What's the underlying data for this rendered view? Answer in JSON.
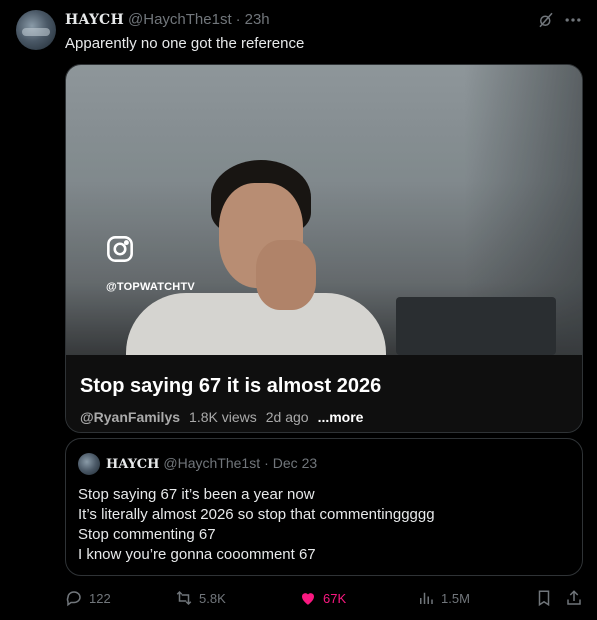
{
  "tweet": {
    "display_name": "HAYCH",
    "handle": "@HaychThe1st",
    "separator": "·",
    "time": "23h",
    "text": "Apparently no one got the reference"
  },
  "media": {
    "overlay_handle": "@TOPWATCHTV",
    "title": "Stop saying 67 it is almost 2026",
    "channel": "@RyanFamilys",
    "views": "1.8K views",
    "age": "2d ago",
    "more_label": "...more"
  },
  "quote": {
    "display_name": "HAYCH",
    "handle": "@HaychThe1st",
    "separator": "·",
    "date": "Dec 23",
    "lines": [
      "Stop saying 67 it’s been a year now",
      "It’s literally almost 2026 so stop that commentinggggg",
      "Stop commenting 67",
      "I know you’re gonna cooomment 67"
    ]
  },
  "actions": {
    "replies": "122",
    "reposts": "5.8K",
    "likes": "67K",
    "views": "1.5M"
  },
  "icons": {
    "grok": "grok-icon",
    "more": "more-icon",
    "instagram": "instagram-icon",
    "reply": "reply-icon",
    "retweet": "retweet-icon",
    "like": "heart-icon",
    "views": "views-icon",
    "bookmark": "bookmark-icon",
    "share": "share-icon"
  },
  "colors": {
    "background": "#000000",
    "text": "#e7e9ea",
    "muted": "#71767b",
    "like_active": "#f91880",
    "border": "#2f3336"
  }
}
